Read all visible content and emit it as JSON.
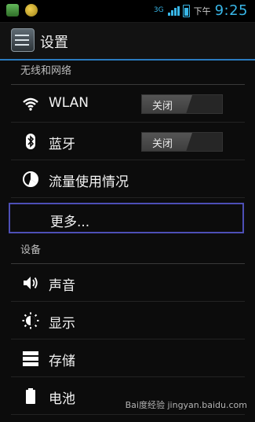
{
  "status_bar": {
    "network": "3G",
    "ampm": "下午",
    "time": "9:25"
  },
  "header": {
    "title": "设置"
  },
  "sections": {
    "wireless": "无线和网络",
    "device": "设备"
  },
  "items": {
    "wlan": {
      "label": "WLAN",
      "toggle": "关闭"
    },
    "bluetooth": {
      "label": "蓝牙",
      "toggle": "关闭"
    },
    "data_usage": {
      "label": "流量使用情况"
    },
    "more": {
      "label": "更多..."
    },
    "sound": {
      "label": "声音"
    },
    "display": {
      "label": "显示"
    },
    "storage": {
      "label": "存储"
    },
    "battery": {
      "label": "电池"
    }
  },
  "watermark": "Bai度经验 jingyan.baidu.com",
  "colors": {
    "accent": "#2a7bbf",
    "status_blue": "#38b6e7",
    "selection": "#4d4fb6"
  }
}
